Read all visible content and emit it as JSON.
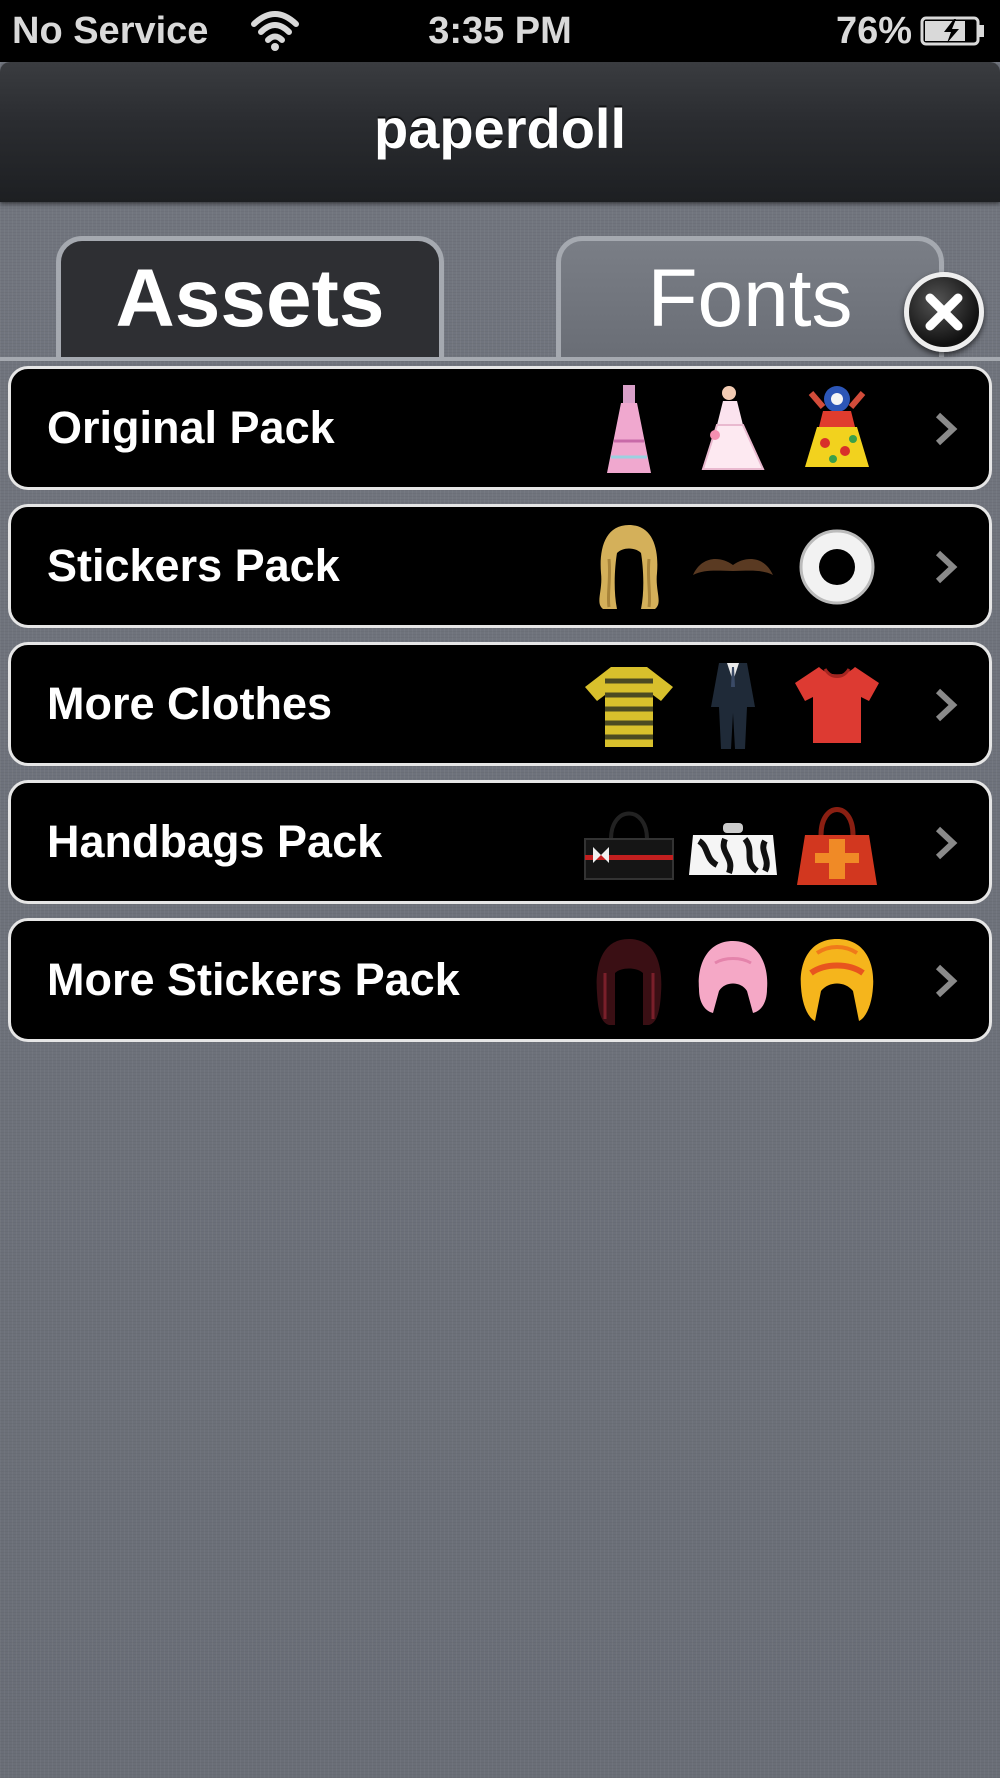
{
  "status_bar": {
    "carrier": "No Service",
    "time": "3:35 PM",
    "battery_percent": "76%"
  },
  "nav": {
    "title": "paperdoll"
  },
  "tabs": [
    {
      "label": "Assets",
      "selected": true
    },
    {
      "label": "Fonts",
      "selected": false
    }
  ],
  "packs": [
    {
      "label": "Original Pack",
      "thumbs": [
        "pink-gown-icon",
        "white-dress-icon",
        "floral-dress-icon"
      ]
    },
    {
      "label": "Stickers Pack",
      "thumbs": [
        "blonde-wig-icon",
        "mustache-icon",
        "ring-icon"
      ]
    },
    {
      "label": "More Clothes",
      "thumbs": [
        "striped-shirt-icon",
        "suit-icon",
        "red-top-icon"
      ]
    },
    {
      "label": "Handbags Pack",
      "thumbs": [
        "black-handbag-icon",
        "zebra-purse-icon",
        "red-handbag-icon"
      ]
    },
    {
      "label": "More Stickers Pack",
      "thumbs": [
        "dark-wig-icon",
        "pink-wig-icon",
        "orange-wig-icon"
      ]
    }
  ]
}
